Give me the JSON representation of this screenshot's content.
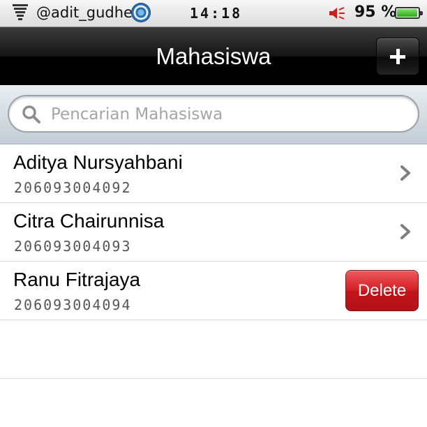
{
  "status_bar": {
    "carrier": "@adit_gudhel",
    "time": "14:18",
    "battery_percent": "95 %",
    "battery_level": 0.95,
    "battery_color": "#2ea81b"
  },
  "nav": {
    "title": "Mahasiswa",
    "add_icon": "plus-icon"
  },
  "search": {
    "placeholder": "Pencarian Mahasiswa",
    "icon": "search-icon"
  },
  "students": [
    {
      "name": "Aditya Nursyahbani",
      "nim": "206093004092",
      "accessory": "chevron"
    },
    {
      "name": "Citra Chairunnisa",
      "nim": "206093004093",
      "accessory": "chevron"
    },
    {
      "name": "Ranu Fitrajaya",
      "nim": "206093004094",
      "accessory": "delete",
      "delete_label": "Delete"
    }
  ],
  "colors": {
    "delete": "#d21d24",
    "navbar": "#000000"
  }
}
